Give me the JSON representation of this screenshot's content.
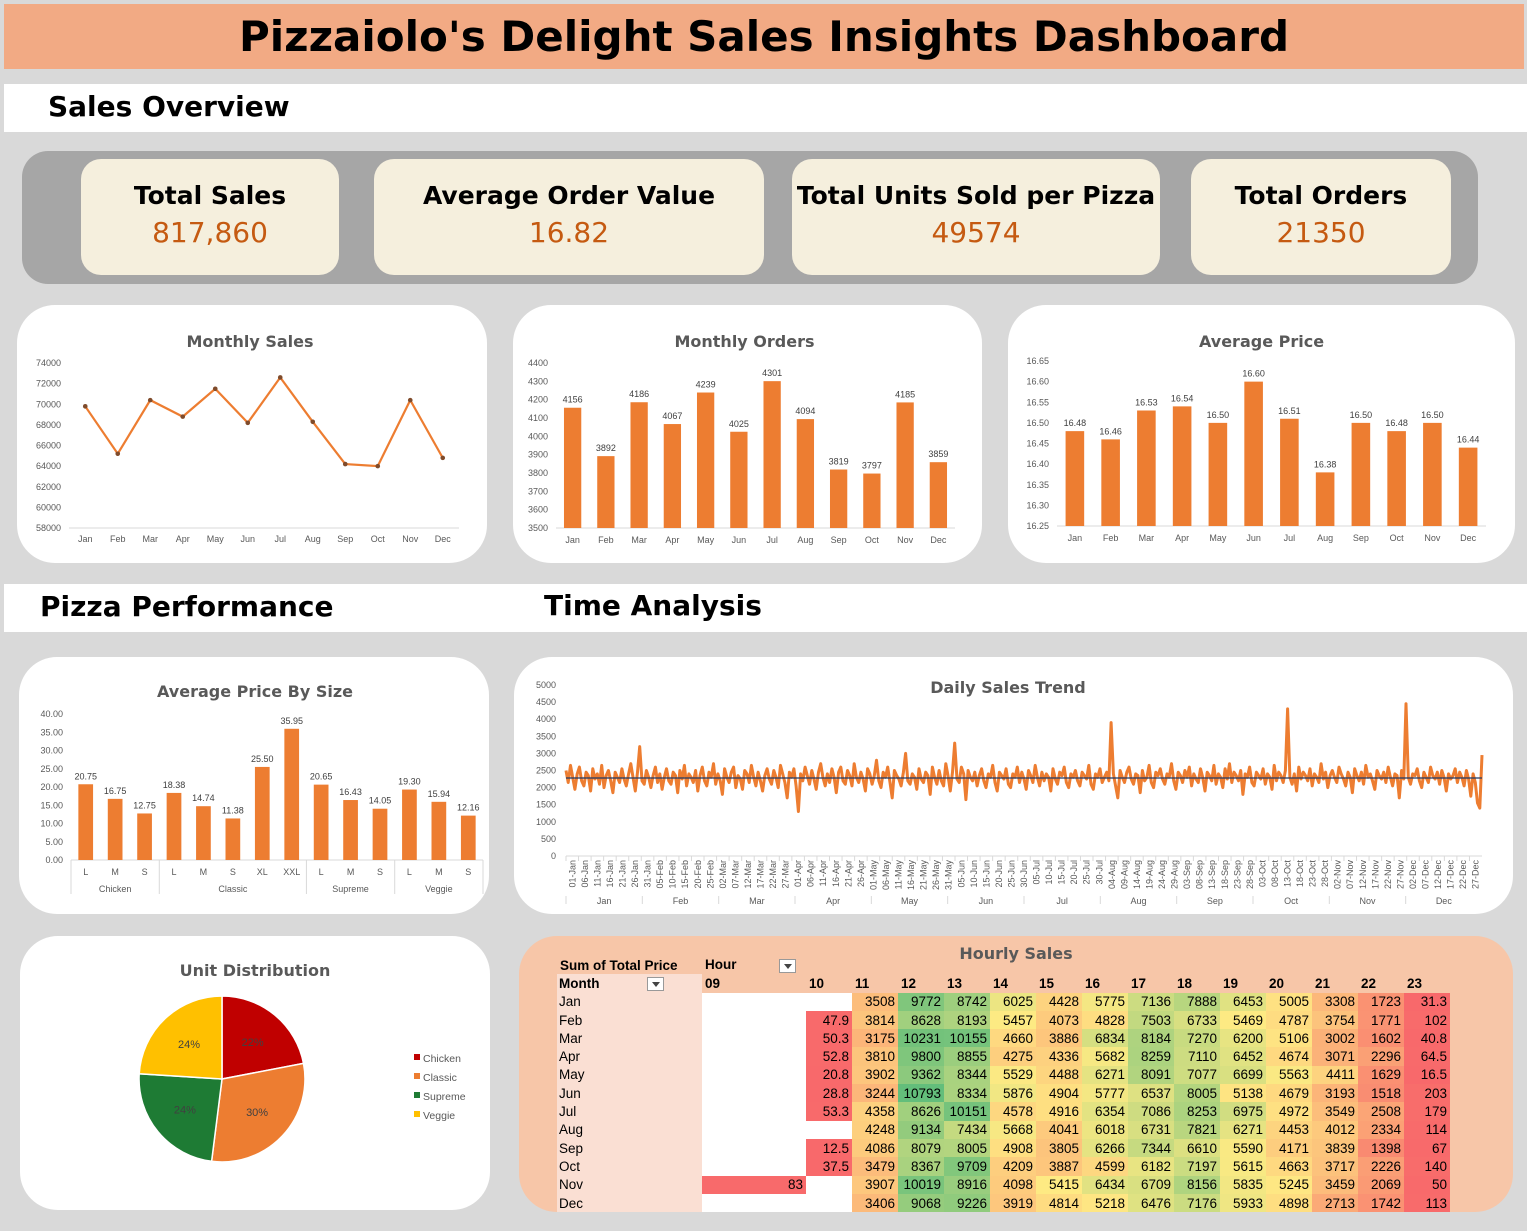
{
  "dashboard": {
    "title": "Pizzaiolo's Delight Sales Insights Dashboard",
    "sections": {
      "overview": "Sales Overview",
      "pizza": "Pizza Performance",
      "time": "Time Analysis"
    }
  },
  "kpis": [
    {
      "label": "Total Sales",
      "value": "817,860"
    },
    {
      "label": "Average Order Value",
      "value": "16.82"
    },
    {
      "label": "Total Units Sold per Pizza",
      "value": "49574"
    },
    {
      "label": "Total Orders",
      "value": "21350"
    }
  ],
  "colors": {
    "accent": "#ed7d31",
    "title_band": "#f2aa84",
    "kpi_value": "#c55a11",
    "kpi_band": "#a6a6a6",
    "kpi_card": "#f5efdd",
    "hourly_panel": "#f7c6a8",
    "chicken": "#c00000",
    "classic": "#ed7d31",
    "supreme": "#1e7b34",
    "veggie": "#ffc000"
  },
  "chart_data": [
    {
      "id": "monthly_sales",
      "type": "line",
      "title": "Monthly Sales",
      "categories": [
        "Jan",
        "Feb",
        "Mar",
        "Apr",
        "May",
        "Jun",
        "Jul",
        "Aug",
        "Sep",
        "Oct",
        "Nov",
        "Dec"
      ],
      "values": [
        69800,
        65200,
        70400,
        68800,
        71500,
        68200,
        72600,
        68300,
        64200,
        64000,
        70400,
        64800
      ],
      "ylim": [
        58000,
        74000
      ],
      "yticks": [
        "74000",
        "72000",
        "70000",
        "68000",
        "66000",
        "64000",
        "62000",
        "60000",
        "58000"
      ]
    },
    {
      "id": "monthly_orders",
      "type": "bar",
      "title": "Monthly Orders",
      "categories": [
        "Jan",
        "Feb",
        "Mar",
        "Apr",
        "May",
        "Jun",
        "Jul",
        "Aug",
        "Sep",
        "Oct",
        "Nov",
        "Dec"
      ],
      "values": [
        4156,
        3892,
        4186,
        4067,
        4239,
        4025,
        4301,
        4094,
        3819,
        3797,
        4185,
        3859
      ],
      "labels": [
        "4156",
        "3892",
        "4186",
        "4067",
        "4239",
        "4025",
        "4301",
        "4094",
        "3819",
        "3797",
        "4185",
        "3859"
      ],
      "ylim": [
        3500,
        4400
      ],
      "yticks": [
        "4400",
        "4300",
        "4200",
        "4100",
        "4000",
        "3900",
        "3800",
        "3700",
        "3600",
        "3500"
      ]
    },
    {
      "id": "average_price",
      "type": "bar",
      "title": "Average Price",
      "categories": [
        "Jan",
        "Feb",
        "Mar",
        "Apr",
        "May",
        "Jun",
        "Jul",
        "Aug",
        "Sep",
        "Oct",
        "Nov",
        "Dec"
      ],
      "values": [
        16.48,
        16.46,
        16.53,
        16.54,
        16.5,
        16.6,
        16.51,
        16.38,
        16.5,
        16.48,
        16.5,
        16.44
      ],
      "labels": [
        "16.48",
        "16.46",
        "16.53",
        "16.54",
        "16.50",
        "16.60",
        "16.51",
        "16.38",
        "16.50",
        "16.48",
        "16.50",
        "16.44"
      ],
      "ylim": [
        16.25,
        16.65
      ],
      "yticks": [
        "16.65",
        "16.60",
        "16.55",
        "16.50",
        "16.45",
        "16.40",
        "16.35",
        "16.30",
        "16.25"
      ]
    },
    {
      "id": "avg_price_by_size",
      "type": "bar",
      "title": "Average Price By Size",
      "groups": [
        {
          "name": "Chicken",
          "sizes": [
            "L",
            "M",
            "S"
          ],
          "values": [
            20.75,
            16.75,
            12.75
          ],
          "labels": [
            "20.75",
            "16.75",
            "12.75"
          ]
        },
        {
          "name": "Classic",
          "sizes": [
            "L",
            "M",
            "S",
            "XL",
            "XXL"
          ],
          "values": [
            18.38,
            14.74,
            11.38,
            25.5,
            35.95
          ],
          "labels": [
            "18.38",
            "14.74",
            "11.38",
            "25.50",
            "35.95"
          ]
        },
        {
          "name": "Supreme",
          "sizes": [
            "L",
            "M",
            "S"
          ],
          "values": [
            20.65,
            16.43,
            14.05
          ],
          "labels": [
            "20.65",
            "16.43",
            "14.05"
          ]
        },
        {
          "name": "Veggie",
          "sizes": [
            "L",
            "M",
            "S"
          ],
          "values": [
            19.3,
            15.94,
            12.16
          ],
          "labels": [
            "19.30",
            "15.94",
            "12.16"
          ]
        }
      ],
      "ylim": [
        0,
        40
      ],
      "yticks": [
        "40.00",
        "35.00",
        "30.00",
        "25.00",
        "20.00",
        "15.00",
        "10.00",
        "5.00",
        "0.00"
      ]
    },
    {
      "id": "daily_sales_trend",
      "type": "line",
      "title": "Daily Sales Trend",
      "ylim": [
        0,
        5000
      ],
      "yticks": [
        "5000",
        "4500",
        "4000",
        "3500",
        "3000",
        "2500",
        "2000",
        "1500",
        "1000",
        "500",
        "0"
      ],
      "average_line": 2280,
      "months": [
        "Jan",
        "Feb",
        "Mar",
        "Apr",
        "May",
        "Jun",
        "Jul",
        "Aug",
        "Sep",
        "Oct",
        "Nov",
        "Dec"
      ],
      "date_labels": [
        "01-Jan",
        "06-Jan",
        "11-Jan",
        "16-Jan",
        "21-Jan",
        "26-Jan",
        "31-Jan",
        "05-Feb",
        "10-Feb",
        "15-Feb",
        "20-Feb",
        "25-Feb",
        "02-Mar",
        "07-Mar",
        "12-Mar",
        "17-Mar",
        "22-Mar",
        "27-Mar",
        "01-Apr",
        "06-Apr",
        "11-Apr",
        "16-Apr",
        "21-Apr",
        "26-Apr",
        "01-May",
        "06-May",
        "11-May",
        "16-May",
        "21-May",
        "26-May",
        "31-May",
        "05-Jun",
        "10-Jun",
        "15-Jun",
        "20-Jun",
        "25-Jun",
        "30-Jun",
        "05-Jul",
        "10-Jul",
        "15-Jul",
        "20-Jul",
        "25-Jul",
        "30-Jul",
        "04-Aug",
        "09-Aug",
        "14-Aug",
        "19-Aug",
        "24-Aug",
        "29-Aug",
        "03-Sep",
        "08-Sep",
        "13-Sep",
        "18-Sep",
        "23-Sep",
        "28-Sep",
        "03-Oct",
        "08-Oct",
        "13-Oct",
        "18-Oct",
        "23-Oct",
        "28-Oct",
        "02-Nov",
        "07-Nov",
        "12-Nov",
        "17-Nov",
        "22-Nov",
        "27-Nov",
        "02-Dec",
        "07-Dec",
        "12-Dec",
        "17-Dec",
        "22-Dec",
        "27-Dec"
      ],
      "values": [
        2500,
        2150,
        2650,
        2300,
        1950,
        2400,
        2600,
        2200,
        2050,
        2450,
        2350,
        1900,
        2550,
        2250,
        2400,
        2100,
        2650,
        2000,
        2350,
        2500,
        2200,
        1850,
        2450,
        2300,
        2150,
        2550,
        2250,
        2050,
        2400,
        2700,
        2300,
        1900,
        2450,
        3200,
        2200,
        2100,
        2500,
        2300,
        2000,
        2350,
        2600,
        2150,
        2400,
        1950,
        2300,
        2550,
        2200,
        2100,
        2450,
        2350,
        1850,
        2500,
        2250,
        2650,
        2050,
        2400,
        2300,
        2150,
        2500,
        1900,
        2350,
        2600,
        2200,
        2050,
        2450,
        2300,
        2700,
        2100,
        2400,
        2200,
        1800,
        2550,
        2300,
        2150,
        2450,
        2600,
        2000,
        2350,
        2250,
        1950,
        2500,
        2400,
        2150,
        2650,
        2300,
        2050,
        2450,
        2200,
        1900,
        2350,
        2550,
        2250,
        2100,
        2500,
        2300,
        2000,
        2650,
        2400,
        2150,
        1700,
        2450,
        2300,
        2550,
        2050,
        1300,
        2400,
        2200,
        2600,
        2350,
        2100,
        2500,
        2250,
        1950,
        2450,
        2700,
        2300,
        2050,
        2400,
        2150,
        2550,
        2300,
        1850,
        2450,
        2600,
        2200,
        2100,
        2500,
        2350,
        2050,
        2700,
        2300,
        2150,
        2450,
        2250,
        1900,
        2550,
        2400,
        2100,
        2350,
        2800,
        2200,
        2000,
        2450,
        2300,
        2600,
        2150,
        1700,
        2500,
        2350,
        2250,
        2050,
        2450,
        3000,
        2200,
        2100,
        2400,
        2300,
        1950,
        2550,
        2250,
        2150,
        2450,
        2350,
        1800,
        2600,
        2300,
        2100,
        2500,
        2200,
        2050,
        2700,
        2350,
        1900,
        2450,
        3300,
        2250,
        2150,
        2600,
        2400,
        1650,
        2500,
        2300,
        2200,
        2450,
        2050,
        2350,
        2550,
        2200,
        2000,
        2400,
        2300,
        2650,
        2150,
        1900,
        2450,
        2350,
        2250,
        2550,
        2100,
        2000,
        2400,
        2300,
        2600,
        2150,
        2450,
        2250,
        1950,
        2500,
        2350,
        2150,
        2650,
        2300,
        2050,
        2450,
        2200,
        2400,
        2300,
        1900,
        2550,
        2250,
        2100,
        2450,
        2350,
        2600,
        2150,
        2000,
        2400,
        2300,
        2500,
        2200,
        2050,
        2450,
        2350,
        2250,
        2650,
        2100,
        1950,
        2400,
        2300,
        2550,
        2150,
        2300,
        2450,
        2200,
        3900,
        2400,
        2050,
        1700,
        2500,
        2300,
        2150,
        2450,
        2600,
        2250,
        2100,
        2400,
        2350,
        1850,
        2500,
        2200,
        2300,
        2650,
        2150,
        2000,
        2450,
        2350,
        2550,
        2250,
        2100,
        2400,
        2300,
        2700,
        2200,
        1950,
        2450,
        2350,
        2150,
        2500,
        2300,
        2600,
        2050,
        2400,
        2250,
        2150,
        2550,
        2300,
        1900,
        2450,
        2350,
        2200,
        2650,
        2100,
        2400,
        2300,
        2000,
        2550,
        2250,
        2700,
        2150,
        2450,
        2350,
        2200,
        2500,
        1800,
        2400,
        2300,
        2600,
        2150,
        2050,
        2450,
        2350,
        2250,
        2550,
        2100,
        2400,
        2300,
        1950,
        2650,
        2200,
        2450,
        2350,
        2150,
        2500,
        4300,
        2300,
        2100,
        2400,
        1900,
        2600,
        2250,
        2450,
        2350,
        2200,
        2550,
        2050,
        2400,
        2300,
        2150,
        2700,
        2250,
        2450,
        2000,
        2350,
        2500,
        2300,
        2150,
        2600,
        2400,
        2250,
        2050,
        2450,
        2300,
        1850,
        2550,
        2350,
        2200,
        2450,
        2100,
        2650,
        2300,
        2400,
        2200,
        1950,
        2500,
        2350,
        2250,
        2450,
        2150,
        2600,
        2300,
        2050,
        2400,
        2350,
        1700,
        2500,
        2250,
        4450,
        2300,
        2100,
        2400,
        2350,
        2550,
        2200,
        2000,
        2450,
        2300,
        2150,
        2600,
        2350,
        2250,
        2450,
        2100,
        2500,
        2300,
        1900,
        2400,
        2250,
        2350,
        2550,
        2150,
        2450,
        2300,
        2050,
        2500,
        2250,
        1750,
        2400,
        2150,
        1550,
        1400,
        2950
      ]
    },
    {
      "id": "unit_distribution",
      "type": "pie",
      "title": "Unit Distribution",
      "slices": [
        {
          "name": "Chicken",
          "value": 22,
          "label": "22%"
        },
        {
          "name": "Classic",
          "value": 30,
          "label": "30%"
        },
        {
          "name": "Supreme",
          "value": 24,
          "label": "24%"
        },
        {
          "name": "Veggie",
          "value": 24,
          "label": "24%"
        }
      ]
    },
    {
      "id": "hourly_sales",
      "type": "heatmap",
      "title": "Hourly Sales",
      "pivot_value_label": "Sum of Total Price",
      "pivot_col_label": "Hour",
      "pivot_row_label": "Month",
      "hours": [
        "09",
        "10",
        "11",
        "12",
        "13",
        "14",
        "15",
        "16",
        "17",
        "18",
        "19",
        "20",
        "21",
        "22",
        "23"
      ],
      "rows": [
        {
          "month": "Jan",
          "cells": [
            "",
            "",
            "3508",
            "9772",
            "8742",
            "6025",
            "4428",
            "5775",
            "7136",
            "7888",
            "6453",
            "5005",
            "3308",
            "1723",
            "31.3"
          ]
        },
        {
          "month": "Feb",
          "cells": [
            "",
            "47.9",
            "3814",
            "8628",
            "8193",
            "5457",
            "4073",
            "4828",
            "7503",
            "6733",
            "5469",
            "4787",
            "3754",
            "1771",
            "102"
          ]
        },
        {
          "month": "Mar",
          "cells": [
            "",
            "50.3",
            "3175",
            "10231",
            "10155",
            "4660",
            "3886",
            "6834",
            "8184",
            "7270",
            "6200",
            "5106",
            "3002",
            "1602",
            "40.8"
          ]
        },
        {
          "month": "Apr",
          "cells": [
            "",
            "52.8",
            "3810",
            "9800",
            "8855",
            "4275",
            "4336",
            "5682",
            "8259",
            "7110",
            "6452",
            "4674",
            "3071",
            "2296",
            "64.5"
          ]
        },
        {
          "month": "May",
          "cells": [
            "",
            "20.8",
            "3902",
            "9362",
            "8344",
            "5529",
            "4488",
            "6271",
            "8091",
            "7077",
            "6699",
            "5563",
            "4411",
            "1629",
            "16.5"
          ]
        },
        {
          "month": "Jun",
          "cells": [
            "",
            "28.8",
            "3244",
            "10793",
            "8334",
            "5876",
            "4904",
            "5777",
            "6537",
            "8005",
            "5138",
            "4679",
            "3193",
            "1518",
            "203"
          ]
        },
        {
          "month": "Jul",
          "cells": [
            "",
            "53.3",
            "4358",
            "8626",
            "10151",
            "4578",
            "4916",
            "6354",
            "7086",
            "8253",
            "6975",
            "4972",
            "3549",
            "2508",
            "179"
          ]
        },
        {
          "month": "Aug",
          "cells": [
            "",
            "",
            "4248",
            "9134",
            "7434",
            "5668",
            "4041",
            "6018",
            "6731",
            "7821",
            "6271",
            "4453",
            "4012",
            "2334",
            "114"
          ]
        },
        {
          "month": "Sep",
          "cells": [
            "",
            "12.5",
            "4086",
            "8079",
            "8005",
            "4908",
            "3805",
            "6266",
            "7344",
            "6610",
            "5590",
            "4171",
            "3839",
            "1398",
            "67"
          ]
        },
        {
          "month": "Oct",
          "cells": [
            "",
            "37.5",
            "3479",
            "8367",
            "9709",
            "4209",
            "3887",
            "4599",
            "6182",
            "7197",
            "5615",
            "4663",
            "3717",
            "2226",
            "140"
          ]
        },
        {
          "month": "Nov",
          "cells": [
            "83",
            "",
            "3907",
            "10019",
            "8916",
            "4098",
            "5415",
            "6434",
            "6709",
            "8156",
            "5835",
            "5245",
            "3459",
            "2069",
            "50"
          ]
        },
        {
          "month": "Dec",
          "cells": [
            "",
            "",
            "3406",
            "9068",
            "9226",
            "3919",
            "4814",
            "5218",
            "6476",
            "7176",
            "5933",
            "4898",
            "2713",
            "1742",
            "113"
          ]
        }
      ]
    }
  ]
}
